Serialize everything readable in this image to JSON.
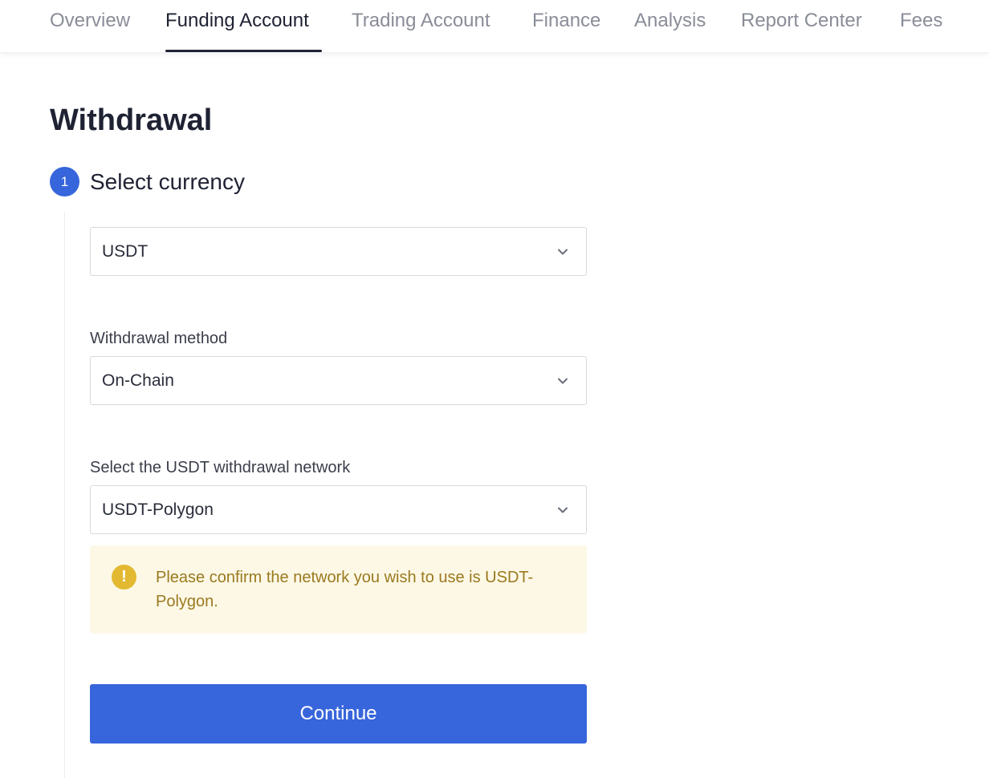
{
  "nav": {
    "tabs": [
      {
        "label": "Overview"
      },
      {
        "label": "Funding Account",
        "active": true
      },
      {
        "label": "Trading Account"
      },
      {
        "label": "Finance"
      },
      {
        "label": "Analysis"
      },
      {
        "label": "Report Center"
      },
      {
        "label": "Fees"
      }
    ]
  },
  "page": {
    "title": "Withdrawal"
  },
  "step": {
    "number": "1",
    "title": "Select currency"
  },
  "form": {
    "currency": {
      "value": "USDT"
    },
    "method": {
      "label": "Withdrawal method",
      "value": "On-Chain"
    },
    "network": {
      "label": "Select the USDT withdrawal network",
      "value": "USDT-Polygon"
    }
  },
  "notice": {
    "icon": "warning-icon",
    "text": "Please confirm the network you wish to use is USDT-Polygon."
  },
  "actions": {
    "continue_label": "Continue"
  },
  "colors": {
    "accent": "#3765db",
    "warning_bg": "#fdf8e6",
    "warning_icon": "#e3b932",
    "warning_text": "#9a7a1f",
    "text_primary": "#1f2233",
    "text_muted": "#8a8d98"
  }
}
